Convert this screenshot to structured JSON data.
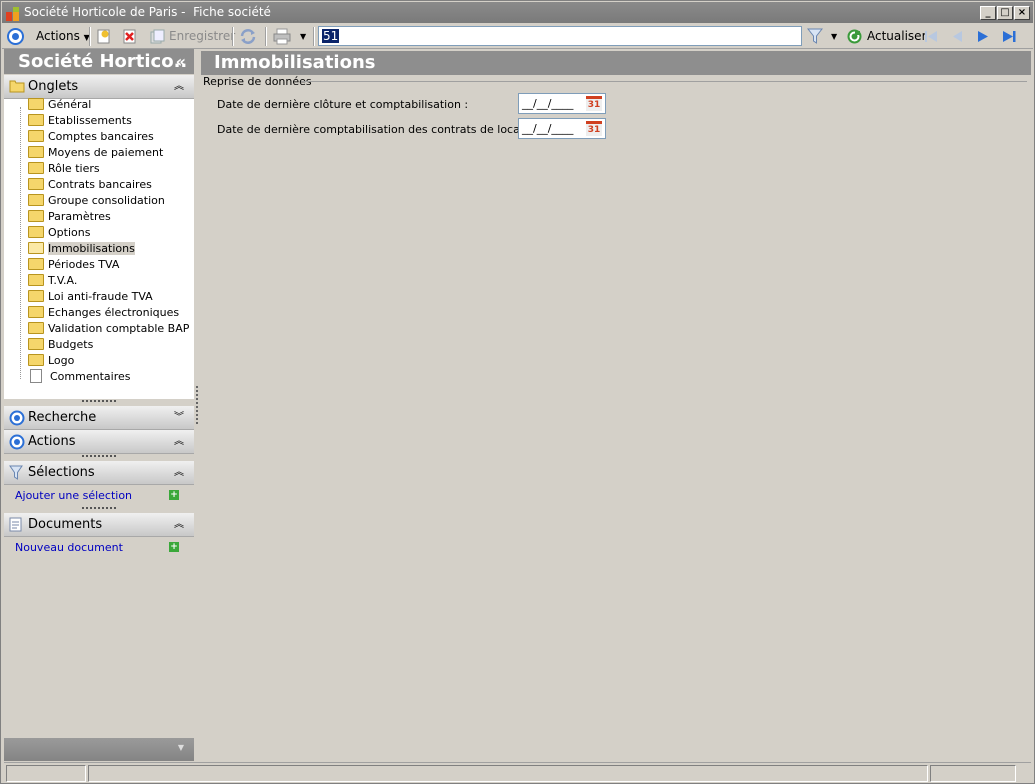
{
  "window": {
    "app_name": "Société Horticole de Paris -",
    "form_title": "Fiche société",
    "minimize": "_",
    "maximize": "□",
    "close": "×"
  },
  "toolbar": {
    "actions_label": "Actions",
    "save_label": "Enregistrer",
    "search_value": "51",
    "refresh_label": "Actualiser"
  },
  "sidebar": {
    "company_title": "Société Hortico..",
    "collapse_glyph": "«",
    "tabs_header": "Onglets",
    "tabs": [
      {
        "label": "Général"
      },
      {
        "label": "Etablissements"
      },
      {
        "label": "Comptes bancaires"
      },
      {
        "label": "Moyens de paiement"
      },
      {
        "label": "Rôle tiers"
      },
      {
        "label": "Contrats bancaires"
      },
      {
        "label": "Groupe consolidation"
      },
      {
        "label": "Paramètres"
      },
      {
        "label": "Options"
      },
      {
        "label": "Immobilisations"
      },
      {
        "label": "Périodes TVA"
      },
      {
        "label": "T.V.A."
      },
      {
        "label": "Loi anti-fraude TVA"
      },
      {
        "label": "Echanges électroniques"
      },
      {
        "label": "Validation comptable BAP"
      },
      {
        "label": "Budgets"
      },
      {
        "label": "Logo"
      },
      {
        "label": "Commentaires"
      }
    ],
    "selected_tab": "Immobilisations",
    "search_header": "Recherche",
    "actions_header": "Actions",
    "selections_header": "Sélections",
    "add_selection_link": "Ajouter une sélection",
    "documents_header": "Documents",
    "new_document_link": "Nouveau document"
  },
  "main": {
    "title": "Immobilisations",
    "group_title": "Reprise de données",
    "fields": [
      {
        "label": "Date de dernière clôture et comptabilisation :",
        "value": "__/__/____"
      },
      {
        "label": "Date de dernière comptabilisation des contrats de location :",
        "value": "__/__/____"
      }
    ],
    "calendar_glyph": "31"
  },
  "colors": {
    "header_bg": "#8e8e8e",
    "link": "#0000c0",
    "nav_arrow": "#2b6fd6"
  }
}
